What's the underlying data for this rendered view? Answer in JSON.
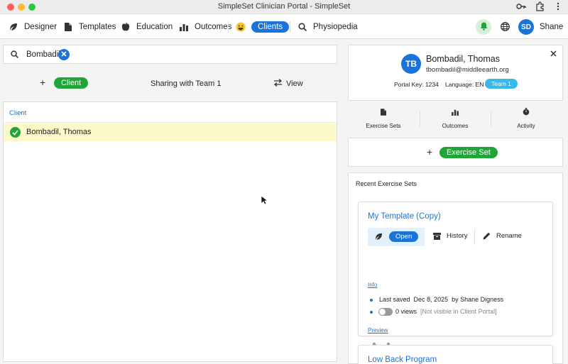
{
  "window": {
    "title": "SimpleSet Clinician Portal - SimpleSet"
  },
  "nav": {
    "items": [
      {
        "label": "Designer",
        "icon": "leaf-icon"
      },
      {
        "label": "Templates",
        "icon": "document-icon"
      },
      {
        "label": "Education",
        "icon": "apple-icon"
      },
      {
        "label": "Outcomes",
        "icon": "bar-chart-icon"
      },
      {
        "label": "Clients",
        "icon": "smiley-icon",
        "active": true
      },
      {
        "label": "Physiopedia",
        "icon": "search-icon"
      }
    ],
    "user_initials": "SD",
    "user_name": "Shane"
  },
  "search": {
    "value": "Bombadil"
  },
  "actions": {
    "add_client_label": "Client",
    "sharing_label": "Sharing with Team 1",
    "view_label": "View"
  },
  "client_list": {
    "header": "Client",
    "rows": [
      {
        "name": "Bombadil, Thomas",
        "selected": true
      }
    ]
  },
  "client_card": {
    "initials": "TB",
    "name": "Bombadil, Thomas",
    "email": "tbombadil@middleearth.org",
    "portal_key": "Portal Key: 1234",
    "language": "Language: EN",
    "team": "Team 1"
  },
  "tabs": [
    {
      "label": "Exercise Sets",
      "icon": "document-icon"
    },
    {
      "label": "Outcomes",
      "icon": "bar-chart-icon"
    },
    {
      "label": "Activity",
      "icon": "stopwatch-icon"
    }
  ],
  "exercise_set": {
    "add_label": "Exercise Set"
  },
  "recent": {
    "title": "Recent Exercise Sets",
    "cards": [
      {
        "title": "My Template (Copy)",
        "open_label": "Open",
        "history_label": "History",
        "rename_label": "Rename",
        "info_label": "Info",
        "last_saved_label": "Last saved",
        "last_saved_date": "Dec 8, 2025",
        "saved_by": "by Shane Digness",
        "views": "0 views",
        "visibility": "[Not visible in Client Portal]",
        "preview_label": "Preview"
      },
      {
        "title": "Low Back Program"
      }
    ]
  },
  "colors": {
    "accent": "#1a73d9",
    "green": "#1fa637",
    "selected_row": "#fcfac8",
    "team_badge": "#3ab8e6"
  }
}
